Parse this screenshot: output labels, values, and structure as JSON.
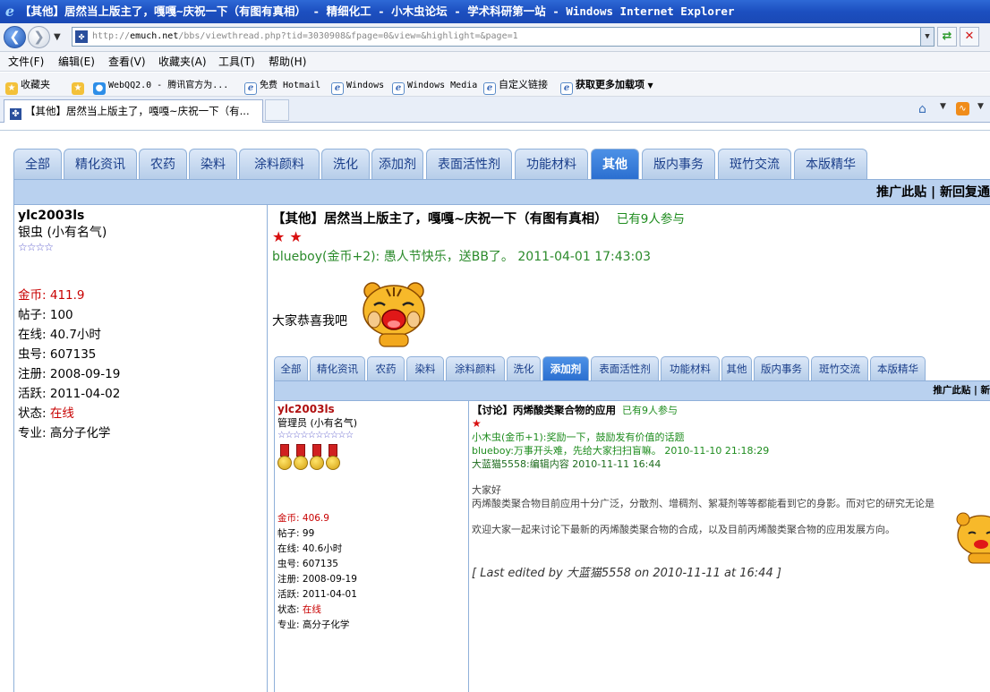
{
  "window": {
    "title": "【其他】居然当上版主了，嘎嘎~庆祝一下（有图有真相） - 精细化工 - 小木虫论坛 - 学术科研第一站 - Windows Internet Explorer"
  },
  "addressbar": {
    "url_prefix": "http://",
    "url_domain": "emuch.net",
    "url_rest": "/bbs/viewthread.php?tid=3030908&fpage=0&view=&highlight=&page=1"
  },
  "menu": {
    "items": [
      "文件(F)",
      "编辑(E)",
      "查看(V)",
      "收藏夹(A)",
      "工具(T)",
      "帮助(H)"
    ]
  },
  "favorites": {
    "label": "收藏夹",
    "items": [
      "WebQQ2.0 - 腾讯官方为...",
      "免费 Hotmail",
      "Windows",
      "Windows Media",
      "自定义链接",
      "获取更多加载项"
    ]
  },
  "browser_tab": {
    "label": "【其他】居然当上版主了，嘎嘎~庆祝一下（有..."
  },
  "forum": {
    "tabs": [
      "全部",
      "精化资讯",
      "农药",
      "染料",
      "涂料颜料",
      "洗化",
      "添加剂",
      "表面活性剂",
      "功能材料",
      "其他",
      "版内事务",
      "斑竹交流",
      "本版精华"
    ],
    "active_tab": "其他",
    "header_actions": "推广此贴 | 新回复通"
  },
  "author": {
    "name": "ylc2003ls",
    "rank": "银虫 (小有名气)",
    "stars": "☆☆☆☆",
    "stats": [
      {
        "label": "金币:",
        "value": "411.9"
      },
      {
        "label": "帖子:",
        "value": "100"
      },
      {
        "label": "在线:",
        "value": "40.7小时"
      },
      {
        "label": "虫号:",
        "value": "607135"
      },
      {
        "label": "注册:",
        "value": "2008-09-19"
      },
      {
        "label": "活跃:",
        "value": "2011-04-02"
      },
      {
        "label": "状态:",
        "value": "在线"
      },
      {
        "label": "专业:",
        "value": "高分子化学"
      }
    ]
  },
  "post": {
    "title": "【其他】居然当上版主了，嘎嘎~庆祝一下（有图有真相）",
    "participants": "已有9人参与",
    "stars": "★ ★",
    "award": "blueboy(金币+2): 愚人节快乐，送BB了。  2011-04-01 17:43:03",
    "text": "大家恭喜我吧"
  },
  "screenshot": {
    "tabs": [
      "全部",
      "精化资讯",
      "农药",
      "染料",
      "涂料颜料",
      "洗化",
      "添加剂",
      "表面活性剂",
      "功能材料",
      "其他",
      "版内事务",
      "斑竹交流",
      "本版精华"
    ],
    "active_tab": "添加剂",
    "header_actions": "推广此贴 | 新",
    "author": {
      "name": "ylc2003ls",
      "rank": "管理员 (小有名气)",
      "stars": "☆☆☆☆☆☆☆☆☆☆",
      "stats": [
        {
          "label": "金币:",
          "value": "406.9"
        },
        {
          "label": "帖子:",
          "value": "99"
        },
        {
          "label": "在线:",
          "value": "40.6小时"
        },
        {
          "label": "虫号:",
          "value": "607135"
        },
        {
          "label": "注册:",
          "value": "2008-09-19"
        },
        {
          "label": "活跃:",
          "value": "2011-04-01"
        },
        {
          "label": "状态:",
          "value": "在线"
        },
        {
          "label": "专业:",
          "value": "高分子化学"
        }
      ]
    },
    "post": {
      "title": "【讨论】丙烯酸类聚合物的应用",
      "participants": "已有9人参与",
      "star": "★",
      "award1": "小木虫(金币+1):奖励一下，鼓励发有价值的话题",
      "award2": "blueboy:万事开头难，先给大家扫扫盲嘛。  2010-11-10 21:18:29",
      "award3": "大蓝猫5558:编辑内容  2010-11-11 16:44",
      "line1": "大家好",
      "line2": "丙烯酸类聚合物目前应用十分广泛，分散剂、增稠剂、絮凝剂等等都能看到它的身影。而对它的研究无论是",
      "line3": "欢迎大家一起来讨论下最新的丙烯酸类聚合物的合成，以及目前丙烯酸类聚合物的应用发展方向。",
      "edit_note": "[ Last edited by 大蓝猫5558 on 2010-11-11 at 16:44 ]"
    }
  }
}
